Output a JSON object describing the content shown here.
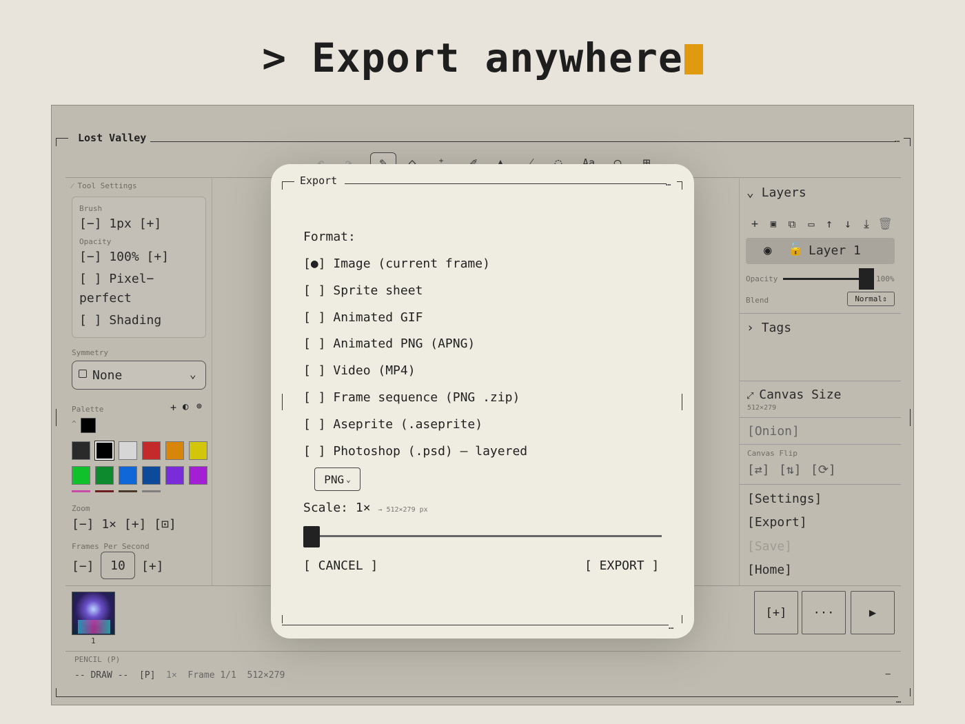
{
  "headline": {
    "prompt": ">",
    "text": "Export anywhere"
  },
  "window": {
    "title": "Lost Valley"
  },
  "toolbar": {
    "icons": [
      "undo-icon",
      "redo-icon",
      "pencil-icon",
      "eraser-icon",
      "magic-wand-icon",
      "eyedropper-icon",
      "fill-icon",
      "line-icon",
      "lasso-icon",
      "text-icon",
      "ellipse-icon",
      "grid-icon"
    ]
  },
  "tool_settings": {
    "title": "Tool Settings",
    "brush_label": "Brush",
    "brush_value": "[−] 1px [+]",
    "opacity_label": "Opacity",
    "opacity_value": "[−] 100% [+]",
    "pixel_perfect_line1": "[ ] Pixel−",
    "pixel_perfect_line2": "perfect",
    "shading": "[ ] Shading"
  },
  "symmetry": {
    "label": "Symmetry",
    "value": "None"
  },
  "palette": {
    "label": "Palette",
    "colors": [
      "#2a2a2a",
      "#000000",
      "#d6d6d6",
      "#c42a2a",
      "#d8860a",
      "#d2c60a",
      "#10c12c",
      "#0d8a2e",
      "#1067d8",
      "#0d4a9a",
      "#7a2cd8",
      "#a21fd4"
    ],
    "strip_colors": [
      "#c94ba8",
      "#6a1e1e",
      "#4a3a2a",
      "#7f7f7f"
    ],
    "current_color": "#000000"
  },
  "zoom": {
    "label": "Zoom",
    "value": "[−] 1× [+] [⊡]"
  },
  "fps": {
    "label": "Frames Per Second",
    "minus": "[−]",
    "value": "10",
    "plus": "[+]"
  },
  "frames": {
    "number": "1"
  },
  "status": {
    "tool": "PENCIL (P)",
    "mode": "-- DRAW --",
    "key": "[P]",
    "zoom": "1×",
    "frame": "Frame 1/1",
    "size": "512×279",
    "minimize": "−"
  },
  "layers": {
    "title": "Layers",
    "layer_name": "Layer 1",
    "opacity_label": "Opacity",
    "opacity_value": "100%",
    "opacity": 1.0,
    "blend_label": "Blend",
    "blend_value": "Normal"
  },
  "tags": {
    "title": "Tags"
  },
  "canvas_size": {
    "title": "Canvas Size",
    "value": "512×279"
  },
  "onion": "[Onion]",
  "canvas_flip": {
    "label": "Canvas Flip",
    "h": "[⇄]",
    "v": "[⇅]",
    "r": "[⟳]"
  },
  "menu": {
    "settings": "[Settings]",
    "export": "[Export]",
    "save": "[Save]",
    "home": "[Home]"
  },
  "frame_buttons": {
    "add": "[+]",
    "more": "···",
    "play": "▶"
  },
  "export_dialog": {
    "title": "Export",
    "format_label": "Format:",
    "options": [
      {
        "mark": "[●]",
        "label": "Image (current frame)"
      },
      {
        "mark": "[ ]",
        "label": "Sprite sheet"
      },
      {
        "mark": "[ ]",
        "label": "Animated GIF"
      },
      {
        "mark": "[ ]",
        "label": "Animated PNG (APNG)"
      },
      {
        "mark": "[ ]",
        "label": "Video (MP4)"
      },
      {
        "mark": "[ ]",
        "label": "Frame sequence (PNG .zip)"
      },
      {
        "mark": "[ ]",
        "label": "Aseprite (.aseprite)"
      },
      {
        "mark": "[ ]",
        "label": "Photoshop (.psd) — layered"
      }
    ],
    "file_type": "PNG",
    "scale_label": "Scale:",
    "scale_value": "1×",
    "scale_px": "→ 512×279 px",
    "scale_fraction": 0.0,
    "cancel": "[ CANCEL ]",
    "export": "[ EXPORT ]"
  }
}
